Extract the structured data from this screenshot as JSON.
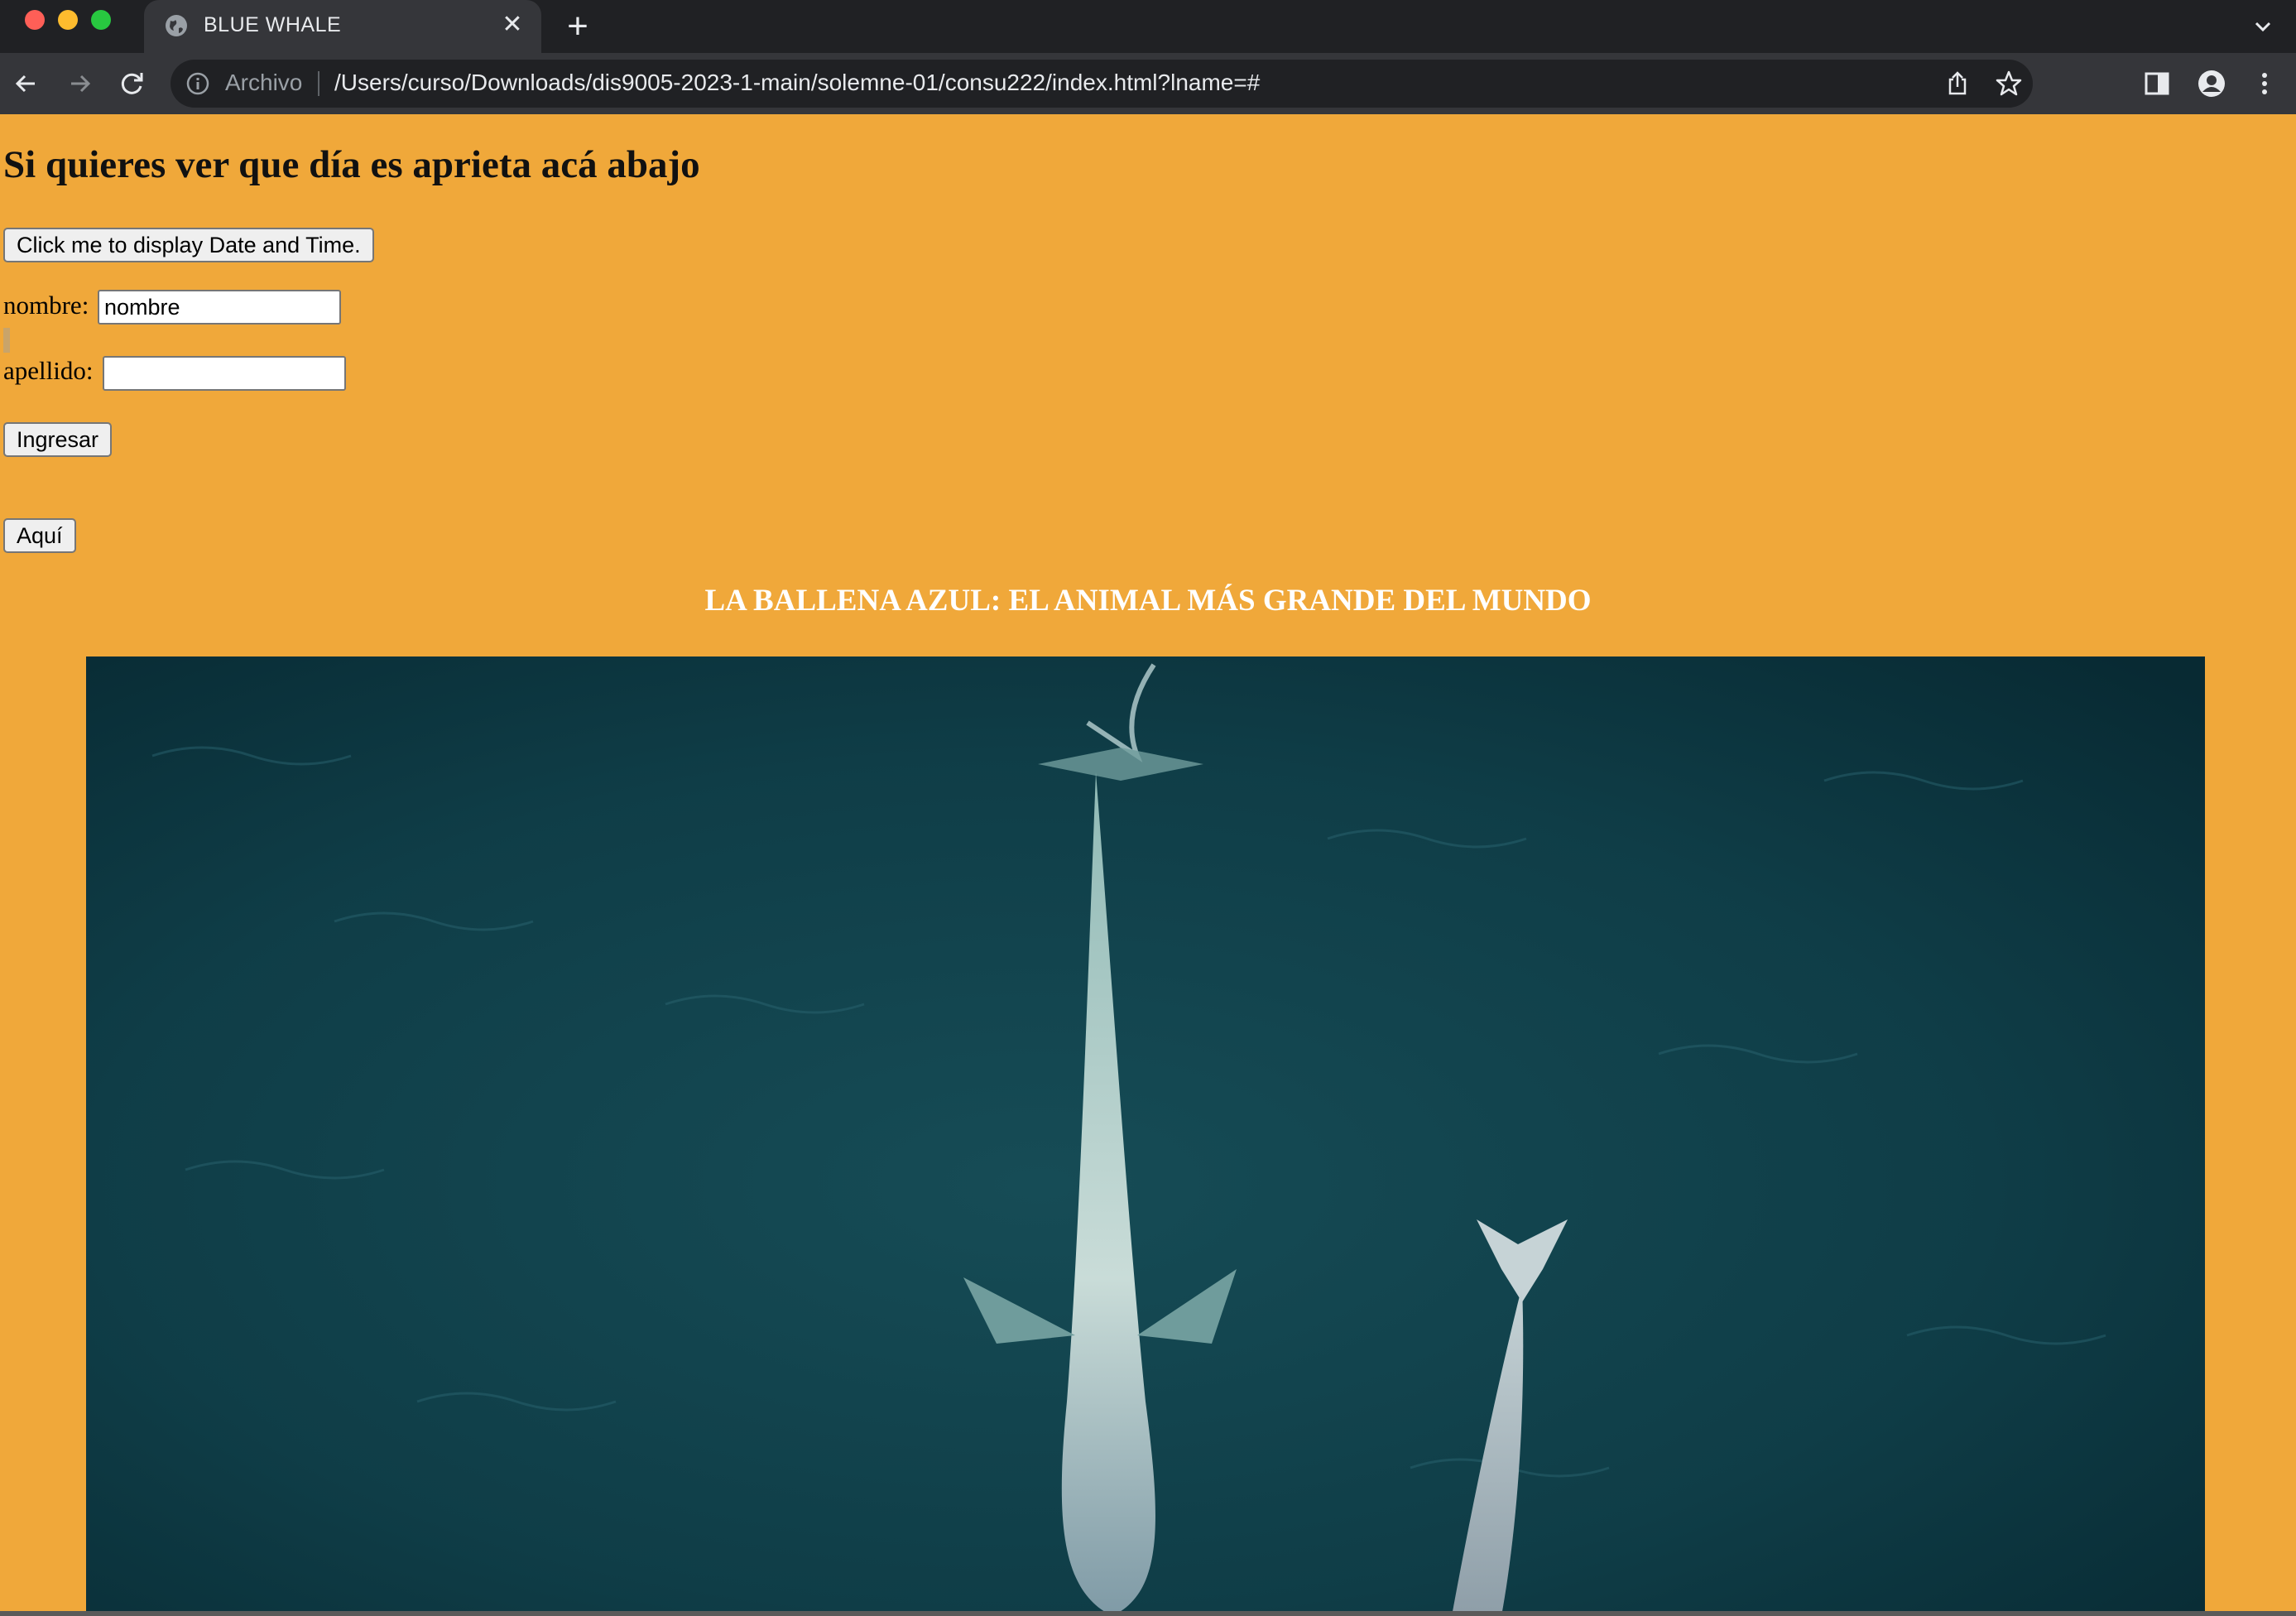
{
  "browser": {
    "tab_title": "BLUE WHALE",
    "tab_close": "✕",
    "new_tab": "+",
    "address_scheme_label": "Archivo",
    "address_url": "/Users/curso/Downloads/dis9005-2023-1-main/solemne-01/consu222/index.html?lname=#",
    "icons": [
      "back-icon",
      "forward-icon",
      "reload-icon",
      "info-icon",
      "share-icon",
      "bookmark-star-icon",
      "side-panel-icon",
      "profile-icon",
      "menu-icon",
      "tab-search-icon"
    ]
  },
  "page": {
    "heading": "Si quieres ver que día es aprieta acá abajo",
    "date_button_label": "Click me to display Date and Time.",
    "nombre_label": "nombre:",
    "nombre_value": "nombre",
    "apellido_label": "apellido:",
    "apellido_value": "",
    "submit_label": "Ingresar",
    "aqui_label": "Aquí",
    "whale_title": "LA BALLENA AZUL: EL ANIMAL MÁS GRANDE DEL MUNDO"
  },
  "colors": {
    "page_background": "#f0a83a",
    "chrome_dark": "#202124",
    "chrome_toolbar": "#35363a",
    "ocean": "#0f3d47"
  }
}
